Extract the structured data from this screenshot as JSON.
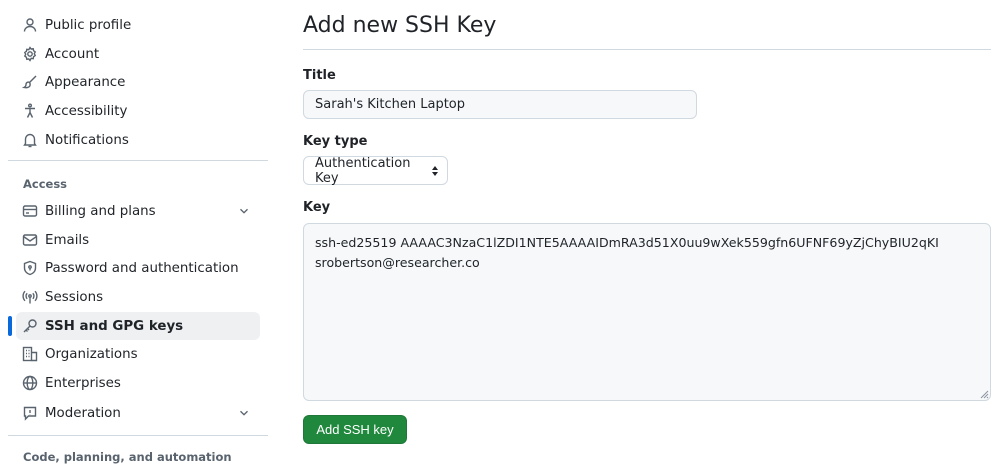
{
  "sidebar": {
    "items": [
      {
        "label": "Public profile",
        "icon": "person-icon"
      },
      {
        "label": "Account",
        "icon": "gear-icon"
      },
      {
        "label": "Appearance",
        "icon": "paintbrush-icon"
      },
      {
        "label": "Accessibility",
        "icon": "accessibility-icon"
      },
      {
        "label": "Notifications",
        "icon": "bell-icon"
      }
    ],
    "access_heading": "Access",
    "access_items": [
      {
        "label": "Billing and plans",
        "icon": "credit-card-icon",
        "expandable": true
      },
      {
        "label": "Emails",
        "icon": "mail-icon"
      },
      {
        "label": "Password and authentication",
        "icon": "shield-lock-icon"
      },
      {
        "label": "Sessions",
        "icon": "broadcast-icon"
      },
      {
        "label": "SSH and GPG keys",
        "icon": "key-icon",
        "active": true
      },
      {
        "label": "Organizations",
        "icon": "organization-icon"
      },
      {
        "label": "Enterprises",
        "icon": "globe-icon"
      },
      {
        "label": "Moderation",
        "icon": "report-icon",
        "expandable": true
      }
    ],
    "next_heading": "Code, planning, and automation"
  },
  "main": {
    "title": "Add new SSH Key",
    "title_field": {
      "label": "Title",
      "value": "Sarah's Kitchen Laptop"
    },
    "key_type_field": {
      "label": "Key type",
      "value": "Authentication Key"
    },
    "key_field": {
      "label": "Key",
      "value": "ssh-ed25519 AAAAC3NzaC1lZDI1NTE5AAAAIDmRA3d51X0uu9wXek559gfn6UFNF69yZjChyBIU2qKI\nsrobertson@researcher.co"
    },
    "submit_label": "Add SSH key"
  },
  "colors": {
    "accent": "#0969da",
    "primary_button": "#1f883d",
    "active_bg": "#eef0f2",
    "border": "#d1d9e0",
    "muted_text": "#59636e"
  }
}
